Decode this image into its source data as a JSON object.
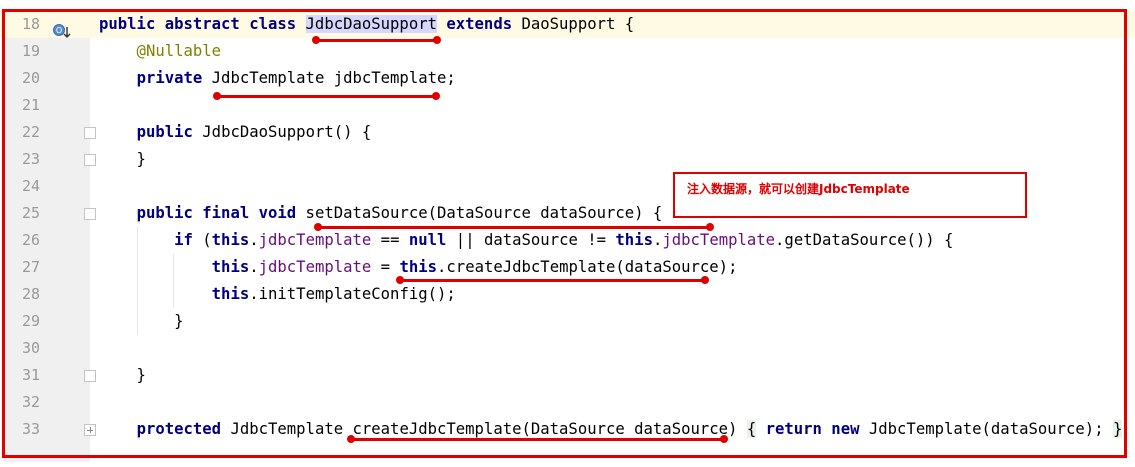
{
  "colors": {
    "keyword": "#000080",
    "annotation": "#808000",
    "field": "#660e7a",
    "line_number": "#999999",
    "current_line_bg": "#fffae3",
    "markup_red": "#e00000"
  },
  "icons": {
    "gutter_override": "override-method-icon",
    "fold": "fold-marker-icon"
  },
  "callout": {
    "text": "注入数据源，就可以创建JdbcTemplate"
  },
  "lines": [
    {
      "n": "18"
    },
    {
      "n": "19",
      "text": "    @Nullable"
    },
    {
      "n": "20"
    },
    {
      "n": "21"
    },
    {
      "n": "22"
    },
    {
      "n": "23",
      "text": "    }"
    },
    {
      "n": "24"
    },
    {
      "n": "25"
    },
    {
      "n": "26"
    },
    {
      "n": "27"
    },
    {
      "n": "28"
    },
    {
      "n": "29",
      "text": "        }"
    },
    {
      "n": "30"
    },
    {
      "n": "31",
      "text": "    }"
    },
    {
      "n": "32"
    },
    {
      "n": "33"
    }
  ],
  "tokens": {
    "l18": {
      "kw": "public abstract class",
      "cls": "JdbcDaoSupport",
      "kw2": "extends",
      "rest": "DaoSupport {"
    },
    "l20": {
      "kw": "private",
      "rest": " JdbcTemplate jdbcTemplate;"
    },
    "l22": {
      "kw": "public",
      "rest": " JdbcDaoSupport() {"
    },
    "l25": {
      "kw": "public final void",
      "rest": " setDataSource(DataSource dataSource) {"
    },
    "l26": {
      "kw1": "if",
      "p1": " (",
      "kw2": "this",
      "p2": ".",
      "f1": "jdbcTemplate",
      "p3": " == ",
      "kw3": "null",
      "p4": " || dataSource != ",
      "kw4": "this",
      "p5": ".",
      "f2": "jdbcTemplate",
      "p6": ".getDataSource()) {"
    },
    "l27": {
      "kw1": "this",
      "p1": ".",
      "f1": "jdbcTemplate",
      "p2": " = ",
      "kw2": "this",
      "p3": ".createJdbcTemplate(dataSource);"
    },
    "l28": {
      "kw1": "this",
      "p1": ".initTemplateConfig();"
    },
    "l33": {
      "kw": "protected",
      "p1": " JdbcTemplate createJdbcTemplate(DataSource dataSource) ",
      "b1": "{",
      "p2": " ",
      "kw2": "return new",
      "p3": " JdbcTemplate(dataSource); ",
      "b2": "}"
    }
  }
}
